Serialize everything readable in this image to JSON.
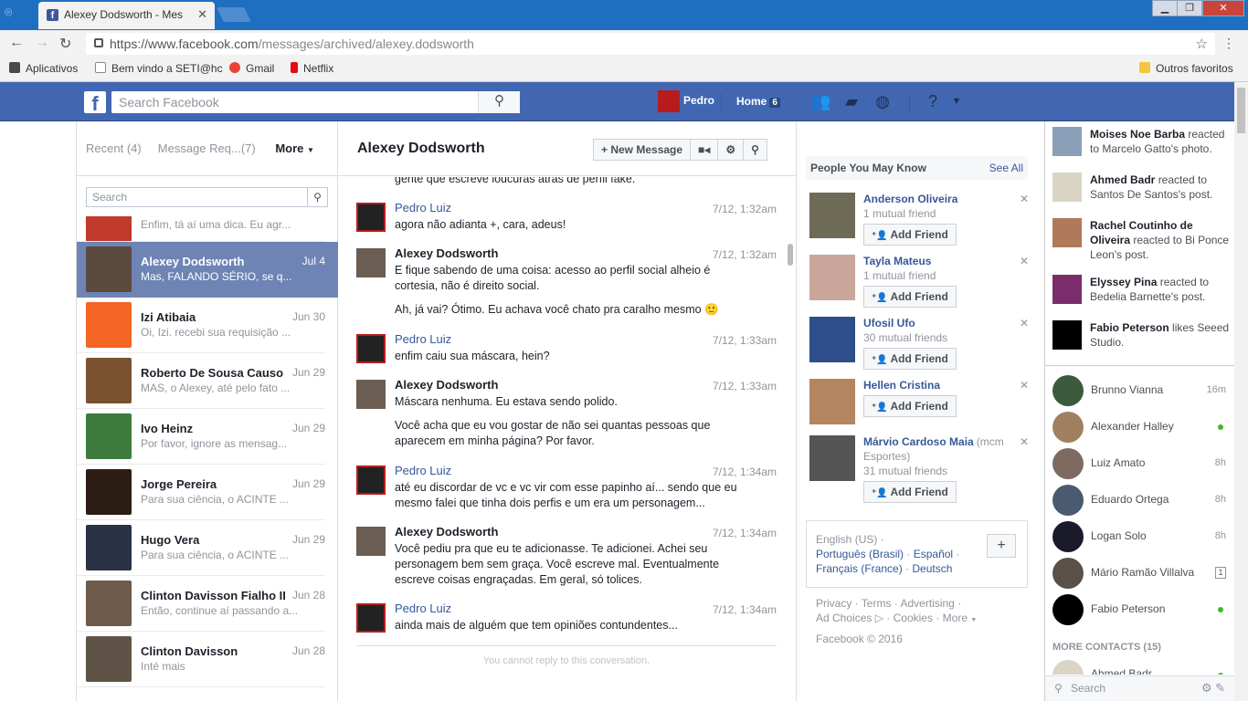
{
  "browser": {
    "tab_title": "Alexey Dodsworth - Mes",
    "url_host": "https://www.facebook.com",
    "url_path": "/messages/archived/alexey.dodsworth",
    "bookmarks": [
      {
        "label": "Aplicativos",
        "color": "#4a4a4a"
      },
      {
        "label": "Bem vindo a SETI@hc",
        "color": "#ffffff"
      },
      {
        "label": "Gmail",
        "color": "#ea4335"
      },
      {
        "label": "Netflix",
        "color": "#e50914"
      }
    ],
    "other_bookmarks": "Outros favoritos"
  },
  "fb": {
    "search_placeholder": "Search Facebook",
    "user": "Pedro",
    "home": "Home",
    "home_count": "6",
    "brand": "#4267b2"
  },
  "left": {
    "tab_recent": "Recent",
    "tab_recent_count": "(4)",
    "tab_requests": "Message Req...",
    "tab_requests_count": "(7)",
    "more": "More",
    "search_placeholder": "Search",
    "partial_snippet": "Enfim, tá aí uma dica. Eu agr...",
    "conversations": [
      {
        "name": "Alexey Dodsworth",
        "date": "Jul 4",
        "snippet": "Mas, FALANDO SÉRIO, se q...",
        "color": "#5c4a3f"
      },
      {
        "name": "Izi Atibaia",
        "date": "Jun 30",
        "snippet": "Oi, Izi. recebi sua requisição ...",
        "color": "#f26522"
      },
      {
        "name": "Roberto De Sousa Causo",
        "date": "Jun 29",
        "snippet": "MAS, o Alexey, até pelo fato ...",
        "color": "#7a5230"
      },
      {
        "name": "Ivo Heinz",
        "date": "Jun 29",
        "snippet": "Por favor, ignore as mensag...",
        "color": "#3d7a3d"
      },
      {
        "name": "Jorge Pereira",
        "date": "Jun 29",
        "snippet": "Para sua ciência, o ACINTE ...",
        "color": "#2c1d14"
      },
      {
        "name": "Hugo Vera",
        "date": "Jun 29",
        "snippet": "Para sua ciência, o ACINTE ...",
        "color": "#2a3345"
      },
      {
        "name": "Clinton Davisson Fialho II",
        "date": "Jun 28",
        "snippet": "Então, continue aí passando a...",
        "color": "#6e5b4b"
      },
      {
        "name": "Clinton Davisson",
        "date": "Jun 28",
        "snippet": "Inté mais",
        "color": "#5f5347"
      }
    ]
  },
  "thread": {
    "title": "Alexey Dodsworth",
    "new_message": "New Message",
    "partial_top": "gente que escreve loucuras atrás de perfil fake.",
    "messages": [
      {
        "who": "Pedro Luiz",
        "time": "7/12, 1:32am",
        "text": "agora não adianta +, cara, adeus!"
      },
      {
        "who": "Alexey Dodsworth",
        "time": "7/12, 1:32am",
        "text": "E fique sabendo de uma coisa: acesso ao perfil social alheio é cortesia, não é direito social.",
        "text2": "Ah, já vai? Ótimo. Eu achava você chato pra caralho mesmo 🙂"
      },
      {
        "who": "Pedro Luiz",
        "time": "7/12, 1:33am",
        "text": "enfim caiu sua máscara, hein?"
      },
      {
        "who": "Alexey Dodsworth",
        "time": "7/12, 1:33am",
        "text": "Máscara nenhuma. Eu estava sendo polido.",
        "text2": "Você acha que eu vou gostar de não sei quantas pessoas que aparecem em minha página? Por favor."
      },
      {
        "who": "Pedro Luiz",
        "time": "7/12, 1:34am",
        "text": "até eu discordar de vc e vc vir com esse papinho aí... sendo que eu mesmo falei que tinha dois perfis e um era um personagem..."
      },
      {
        "who": "Alexey Dodsworth",
        "time": "7/12, 1:34am",
        "text": "Você pediu pra que eu te adicionasse. Te adicionei. Achei seu personagem bem sem graça. Você escreve mal. Eventualmente escreve coisas engraçadas. Em geral, só tolices."
      },
      {
        "who": "Pedro Luiz",
        "time": "7/12, 1:34am",
        "text": "ainda mais de alguém que tem opiniões contundentes..."
      }
    ],
    "footer": "You cannot reply to this conversation."
  },
  "pymk": {
    "title": "People You May Know",
    "see_all": "See All",
    "add_label": "Add Friend",
    "people": [
      {
        "name": "Anderson Oliveira",
        "extra": "",
        "mutual": "1 mutual friend",
        "color": "#6d6a55"
      },
      {
        "name": "Tayla Mateus",
        "extra": "",
        "mutual": "1 mutual friend",
        "color": "#c9a79a"
      },
      {
        "name": "Ufosil Ufo",
        "extra": "",
        "mutual": "30 mutual friends",
        "color": "#2d4e8a"
      },
      {
        "name": "Hellen Cristina",
        "extra": "",
        "mutual": "",
        "color": "#b48660"
      },
      {
        "name": "Márvio Cardoso Maia",
        "extra": "(mcm",
        "extra2": "Esportes)",
        "mutual": "31 mutual friends",
        "color": "#555555"
      }
    ]
  },
  "languages": {
    "current": "English (US)",
    "links": [
      "Português (Brasil)",
      "Español",
      "Français (France)",
      "Deutsch"
    ]
  },
  "footer": {
    "links": [
      "Privacy",
      "Terms",
      "Advertising",
      "Ad Choices",
      "Cookies",
      "More"
    ],
    "copyright": "Facebook © 2016"
  },
  "ticker": [
    {
      "actor": "Moises Noe Barba",
      "rest": "reacted to Marcelo Gatto's photo.",
      "color": "#8aa0b8"
    },
    {
      "actor": "Ahmed Badr",
      "rest": "reacted to Santos De Santos's post.",
      "color": "#d9d4c4"
    },
    {
      "actor": "Rachel Coutinho de Oliveira",
      "rest": "reacted to Bi Ponce Leon's post.",
      "color": "#b0795a"
    },
    {
      "actor": "Elyssey Pina",
      "rest": "reacted to Bedelia Barnette's post.",
      "color": "#7b2d6b"
    },
    {
      "actor": "Fabio Peterson",
      "rest": "likes Seeed Studio.",
      "color": "#000000"
    }
  ],
  "chat": {
    "contacts": [
      {
        "name": "Brunno Vianna",
        "status": "16m",
        "kind": "time",
        "color": "#3c5a3c"
      },
      {
        "name": "Alexander Halley",
        "status": "",
        "kind": "dot",
        "color": "#a08060"
      },
      {
        "name": "Luiz Amato",
        "status": "8h",
        "kind": "time",
        "color": "#7d6a60"
      },
      {
        "name": "Eduardo Ortega",
        "status": "8h",
        "kind": "time",
        "color": "#4a5a70"
      },
      {
        "name": "Logan Solo",
        "status": "8h",
        "kind": "time",
        "color": "#1a1a2a"
      },
      {
        "name": "Mário Ramão Villalva",
        "status": "1",
        "kind": "box",
        "color": "#5a5048"
      },
      {
        "name": "Fabio Peterson",
        "status": "",
        "kind": "dot",
        "color": "#000000"
      }
    ],
    "more_contacts": "MORE CONTACTS (15)",
    "partial_contact": "Ahmed Badr",
    "search_placeholder": "Search"
  }
}
